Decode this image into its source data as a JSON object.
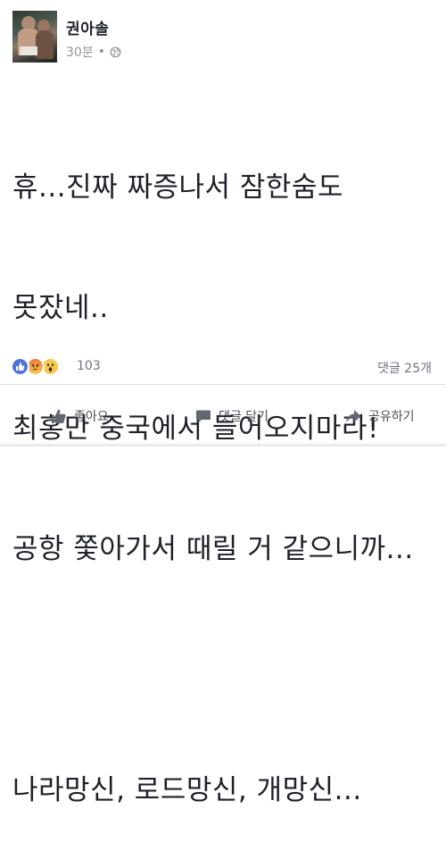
{
  "post": {
    "author": "권아솔",
    "time": "30분",
    "separator": "•",
    "privacy_icon": "globe-icon",
    "lines": [
      "휴...진짜 짜증나서 잠한숨도",
      "못잤네..",
      "최홍만 중국에서 들어오지마라!",
      "공항 쫓아가서 때릴 거 같으니까...",
      "",
      "나라망신, 로드망신, 개망신..."
    ]
  },
  "reactions": {
    "icons": [
      "like-icon",
      "angry-icon",
      "wow-icon"
    ],
    "count": "103",
    "comments": "댓글 25개"
  },
  "actions": {
    "like": "좋아요",
    "comment": "댓글 달기",
    "share": "공유하기"
  },
  "colors": {
    "text": "#1d2129",
    "meta": "#90949c",
    "like_blue": "#4f74d6",
    "wow_yellow": "#f7c94b",
    "angry_orange": "#f07a3c",
    "divider": "#dddfe2"
  }
}
